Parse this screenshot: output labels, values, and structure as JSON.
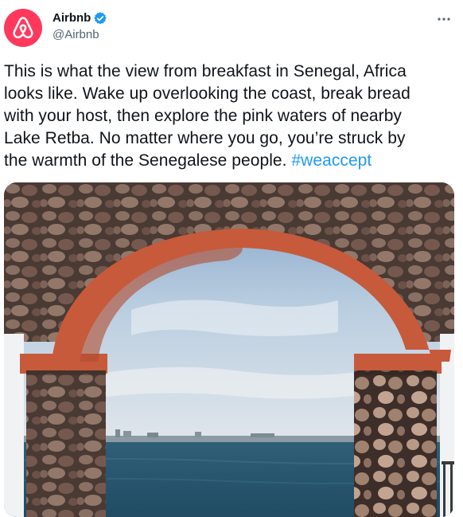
{
  "author": {
    "display_name": "Airbnb",
    "handle": "@Airbnb",
    "verified": true,
    "avatar_icon": "airbnb-logo-icon",
    "brand_color": "#ff385c"
  },
  "tweet": {
    "text": "This is what the view from breakfast in Senegal, Africa\nlooks like. Wake up overlooking the coast, break bread\nwith your host, then explore the pink waters of nearby\nLake Retba. No matter where you go, you’re struck by\nthe warmth of the Senegalese people. ",
    "hashtag": "#weaccept",
    "hashtag_color": "#1d9bf0"
  },
  "media": {
    "photo_icon": "photo-stone-arch-sea-view"
  },
  "menu": {
    "icon": "more-horizontal-icon"
  }
}
